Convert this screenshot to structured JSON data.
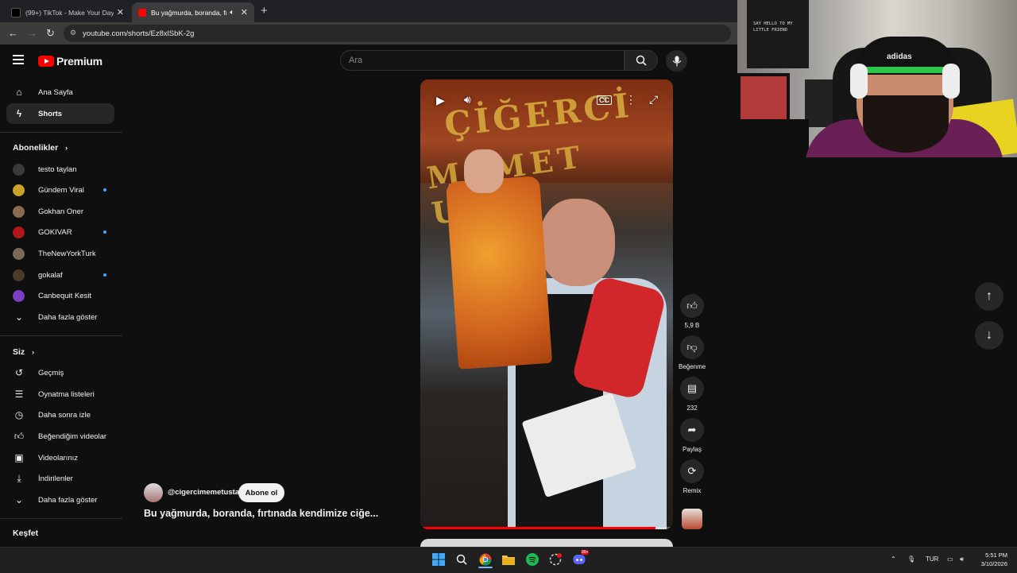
{
  "browser": {
    "tabs": [
      {
        "title": "(99+) TikTok - Make Your Day",
        "active": false
      },
      {
        "title": "Bu yağmurda, boranda, fırtı",
        "active": true
      }
    ],
    "url": "youtube.com/shorts/Ez8xlSbK-2g"
  },
  "header": {
    "logo_text": "Premium",
    "search_placeholder": "Ara"
  },
  "sidebar": {
    "main": [
      {
        "label": "Ana Sayfa",
        "icon": "home-icon"
      },
      {
        "label": "Shorts",
        "icon": "shorts-icon",
        "active": true
      }
    ],
    "subscriptions_heading": "Abonelikler",
    "subscriptions": [
      {
        "label": "testo taylan",
        "color": "#3a3a3a",
        "new": false
      },
      {
        "label": "Gündem Viral",
        "color": "#c9a227",
        "new": true
      },
      {
        "label": "Gokhan Oner",
        "color": "#8a6b4f",
        "new": false
      },
      {
        "label": "GOKIVAR",
        "color": "#b3161b",
        "new": true
      },
      {
        "label": "TheNewYorkTurk",
        "color": "#7a6a58",
        "new": false
      },
      {
        "label": "gokalaf",
        "color": "#4a3b2a",
        "new": true
      },
      {
        "label": "Canbequit Kesit",
        "color": "#7b3fc4",
        "new": false
      }
    ],
    "show_more_1": "Daha fazla göster",
    "you_heading": "Siz",
    "you_items": [
      {
        "label": "Geçmiş",
        "icon": "history-icon"
      },
      {
        "label": "Oynatma listeleri",
        "icon": "playlist-icon"
      },
      {
        "label": "Daha sonra izle",
        "icon": "clock-icon"
      },
      {
        "label": "Beğendiğim videolar",
        "icon": "thumbs-up-icon"
      },
      {
        "label": "Videolarınız",
        "icon": "video-icon"
      },
      {
        "label": "İndirilenler",
        "icon": "download-icon"
      }
    ],
    "show_more_2": "Daha fazla göster",
    "explore_heading": "Keşfet"
  },
  "short": {
    "channel": "@cigercimemetusta",
    "subscribe_label": "Abone ol",
    "title": "Bu yağmurda, boranda, fırtınada kendimize ciğe...",
    "progress": 0.93,
    "actions": {
      "likes": "5,9 B",
      "dislike_label": "Beğenme",
      "comments": "232",
      "share_label": "Paylaş",
      "remix_label": "Remix"
    }
  },
  "webcam": {
    "poster_text": "SAY HELLO TO MY LITTLE FRIEND",
    "cap_brand": "adidas"
  },
  "taskbar": {
    "language": "TUR",
    "time": "5:51 PM",
    "date": "3/10/2026",
    "discord_badge": "99+"
  },
  "colors": {
    "accent": "#ff0000",
    "background": "#0f0f0f",
    "link_dot": "#3ea6ff"
  }
}
